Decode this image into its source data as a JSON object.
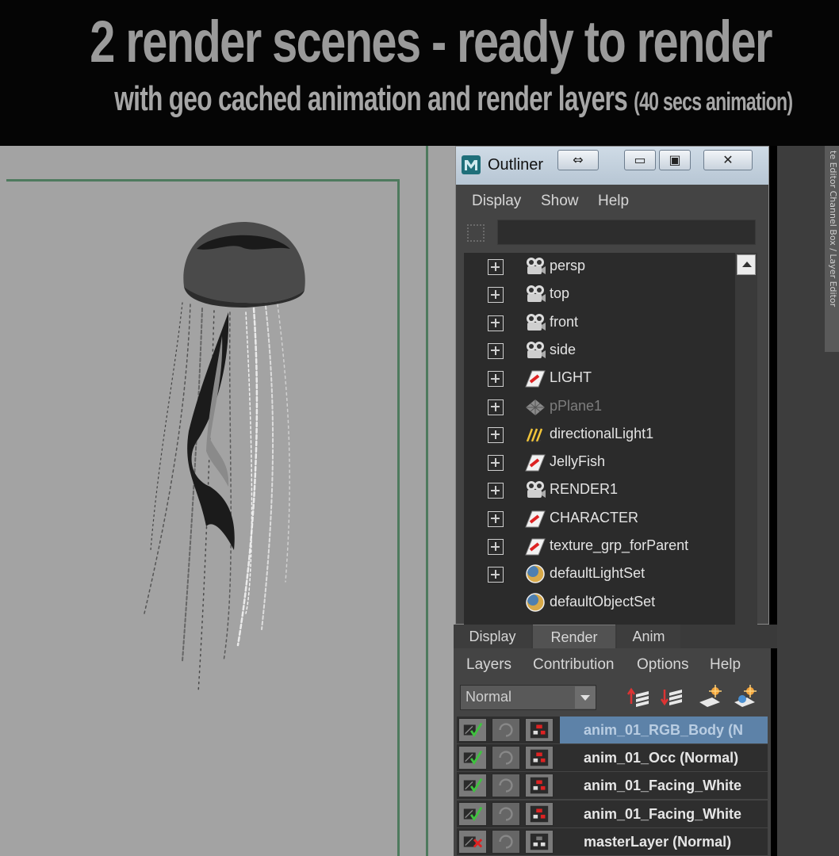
{
  "banner": {
    "title": "2 render scenes - ready to render",
    "subtitle": "with geo cached animation and render layers",
    "subtitle_small": "(40 secs animation)"
  },
  "side_tab": {
    "label": "te Editor   Channel Box / Layer Editor"
  },
  "outliner": {
    "title": "Outliner",
    "buttons": {
      "arrows": "⇔",
      "minimize": "▭",
      "maximize": "▣",
      "close": "✕"
    },
    "menu": [
      "Display",
      "Show",
      "Help"
    ],
    "filter_value": "",
    "items": [
      {
        "label": "persp",
        "icon": "camera-icon",
        "expandable": true,
        "dim": false
      },
      {
        "label": "top",
        "icon": "camera-icon",
        "expandable": true,
        "dim": false
      },
      {
        "label": "front",
        "icon": "camera-icon",
        "expandable": true,
        "dim": false
      },
      {
        "label": "side",
        "icon": "camera-icon",
        "expandable": true,
        "dim": false
      },
      {
        "label": "LIGHT",
        "icon": "group-icon",
        "expandable": true,
        "dim": false
      },
      {
        "label": "pPlane1",
        "icon": "mesh-icon",
        "expandable": true,
        "dim": true
      },
      {
        "label": "directionalLight1",
        "icon": "light-icon",
        "expandable": true,
        "dim": false
      },
      {
        "label": "JellyFish",
        "icon": "group-icon",
        "expandable": true,
        "dim": false
      },
      {
        "label": "RENDER1",
        "icon": "camera-icon",
        "expandable": true,
        "dim": false
      },
      {
        "label": "CHARACTER",
        "icon": "group-icon",
        "expandable": true,
        "dim": false
      },
      {
        "label": "texture_grp_forParent",
        "icon": "group-icon",
        "expandable": true,
        "dim": false
      },
      {
        "label": "defaultLightSet",
        "icon": "set-icon",
        "expandable": true,
        "dim": false
      },
      {
        "label": "defaultObjectSet",
        "icon": "set-icon",
        "expandable": false,
        "dim": false
      }
    ]
  },
  "layer_editor": {
    "tabs": [
      "Display",
      "Render",
      "Anim"
    ],
    "active_tab": "Render",
    "menu": [
      "Layers",
      "Contribution",
      "Options",
      "Help"
    ],
    "mode": "Normal",
    "layers": [
      {
        "name": "anim_01_RGB_Body (N",
        "selected": true,
        "renderable": true
      },
      {
        "name": "anim_01_Occ (Normal)",
        "selected": false,
        "renderable": true
      },
      {
        "name": "anim_01_Facing_White",
        "selected": false,
        "renderable": true
      },
      {
        "name": "anim_01_Facing_White",
        "selected": false,
        "renderable": true
      },
      {
        "name": "masterLayer (Normal)",
        "selected": false,
        "renderable": false
      }
    ]
  }
}
